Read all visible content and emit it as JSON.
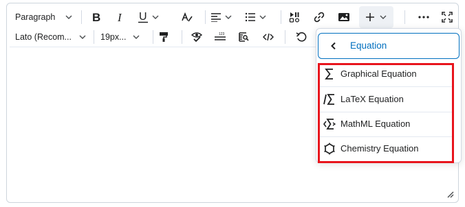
{
  "toolbar": {
    "block_format": "Paragraph",
    "font_family": "Lato (Recom...",
    "font_size": "19px...",
    "icons": [
      "bold-icon",
      "italic-icon",
      "underline-icon",
      "text-color-icon",
      "align-icon",
      "list-icon",
      "media-icon",
      "link-icon",
      "image-icon",
      "insert-plus-icon",
      "more-icon",
      "fullscreen-icon",
      "format-painter-icon",
      "accessibility-check-icon",
      "word-count-icon",
      "preview-icon",
      "source-code-icon",
      "undo-icon"
    ]
  },
  "menu": {
    "header_title": "Equation",
    "items": [
      {
        "label": "Graphical Equation",
        "icon": "sigma-icon"
      },
      {
        "label": "LaTeX Equation",
        "icon": "latex-sigma-icon"
      },
      {
        "label": "MathML Equation",
        "icon": "mathml-sigma-icon"
      },
      {
        "label": "Chemistry Equation",
        "icon": "hexagon-icon"
      }
    ]
  },
  "colors": {
    "accent": "#006fbf",
    "highlight": "#e8141c",
    "border": "#cdd5dc"
  }
}
